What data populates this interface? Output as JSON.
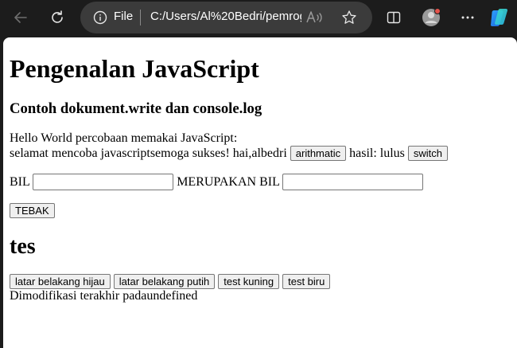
{
  "browser": {
    "file_label": "File",
    "url": "C:/Users/Al%20Bedri/pemrog",
    "toolbar_icons": [
      "back-icon",
      "refresh-icon",
      "info-icon",
      "read-aloud-icon",
      "favorite-icon",
      "split-screen-icon",
      "profile-avatar",
      "more-icon",
      "copilot-icon"
    ],
    "colors": {
      "frame": "#1c1c1c",
      "address_bar": "#3b3b3b",
      "profile_badge": "#e5534b"
    }
  },
  "page": {
    "title": "Pengenalan JavaScript",
    "subtitle": "Contoh dokument.write dan console.log",
    "line1": "Hello World percobaan memakai JavaScript:",
    "line2_text": "selamat mencoba javascriptsemoga sukses! hai,albedri",
    "arith_button": "arithmatic",
    "hasil_text": "hasil: lulus",
    "switch_button": "switch",
    "bil_label": "BIL",
    "bil_value": "",
    "merupakan_label": "MERUPAKAN BIL",
    "merupakan_value": "",
    "tebak_button": "TEBAK",
    "section_title": "tes",
    "buttons": [
      "latar belakang hijau",
      "latar belakang putih",
      "test kuning",
      "test biru"
    ],
    "footer_text": "Dimodifikasi terakhir padaundefined"
  }
}
